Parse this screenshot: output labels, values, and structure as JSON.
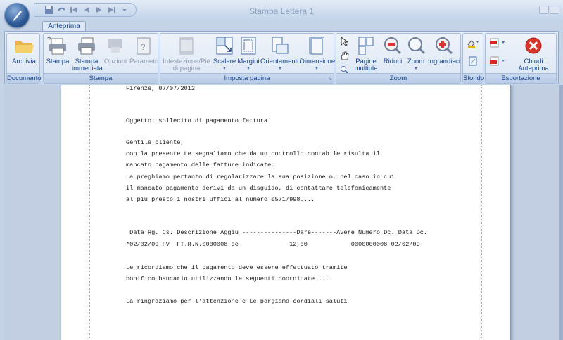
{
  "window": {
    "title": "Stampa Lettera 1"
  },
  "tabs": [
    {
      "label": "Anteprima",
      "active": true
    }
  ],
  "ribbon": {
    "groups": {
      "documento": {
        "label": "Documento",
        "buttons": {
          "archivia": "Archivia"
        }
      },
      "stampa": {
        "label": "Stampa",
        "buttons": {
          "stampa": "Stampa",
          "stampa_immediata": "Stampa immediata",
          "opzioni": "Opzioni",
          "parametri": "Parametri"
        }
      },
      "imposta_pagina": {
        "label": "Imposta pagina",
        "buttons": {
          "intestazione": "Intestazione/Piè di pagina",
          "scalare": "Scalare",
          "margini": "Margini",
          "orientamento": "Orientamento",
          "dimensione": "Dimensione"
        }
      },
      "zoom": {
        "label": "Zoom",
        "buttons": {
          "pagine_multiple": "Pagine multiple",
          "riduci": "Riduci",
          "zoom": "Zoom",
          "ingrandisci": "Ingrandisci"
        }
      },
      "sfondo": {
        "label": "Sfondo"
      },
      "esportazione": {
        "label": "Esportazione",
        "buttons": {
          "chiudi": "Chiudi Anteprima"
        }
      }
    }
  },
  "document": {
    "lines": [
      "Firenze, 07/07/2012",
      "Oggetto: sollecito di pagamento fattura",
      "Gentile cliente,",
      "con la presente Le segnaliamo che da un controllo contabile risulta il",
      "mancato pagamento delle fatture indicate.",
      "La preghiamo pertanto di regolarizzare la sua posizione o, nel caso in cui",
      "il mancato pagamento derivi da un disguido, di contattare telefonicamente",
      "al più presto i nostri uffici al numero 0571/998....",
      " Data Rg. Cs. Descrizione Aggiu ---------------Dare-------Avere Numero Dc. Data Dc.",
      "*02/02/09 FV  FT.R.N.0000008 de              12,00            0000000008 02/02/09",
      "Le ricordiamo che il pagamento deve essere effettuato tramite",
      "bonifico bancario utilizzando le seguenti coordinate ....",
      "La ringraziamo per l'attenzione e Le porgiamo cordiali saluti"
    ]
  },
  "colors": {
    "frame": "#c4d3e6",
    "ribbon_text": "#15428b",
    "close_red": "#d9352b"
  },
  "icons": [
    "app-orb-icon",
    "save-icon",
    "undo-icon",
    "first-page-icon",
    "prev-page-icon",
    "next-page-icon",
    "last-page-icon",
    "folder-icon",
    "printer-icon",
    "printer-fast-icon",
    "options-icon",
    "parameters-icon",
    "header-footer-icon",
    "scale-icon",
    "margins-icon",
    "orientation-icon",
    "page-size-icon",
    "pointer-icon",
    "hand-icon",
    "multi-page-icon",
    "zoom-out-icon",
    "zoom-icon",
    "zoom-in-icon",
    "background-color-icon",
    "watermark-icon",
    "pdf-export-icon",
    "export-icon",
    "close-icon"
  ]
}
